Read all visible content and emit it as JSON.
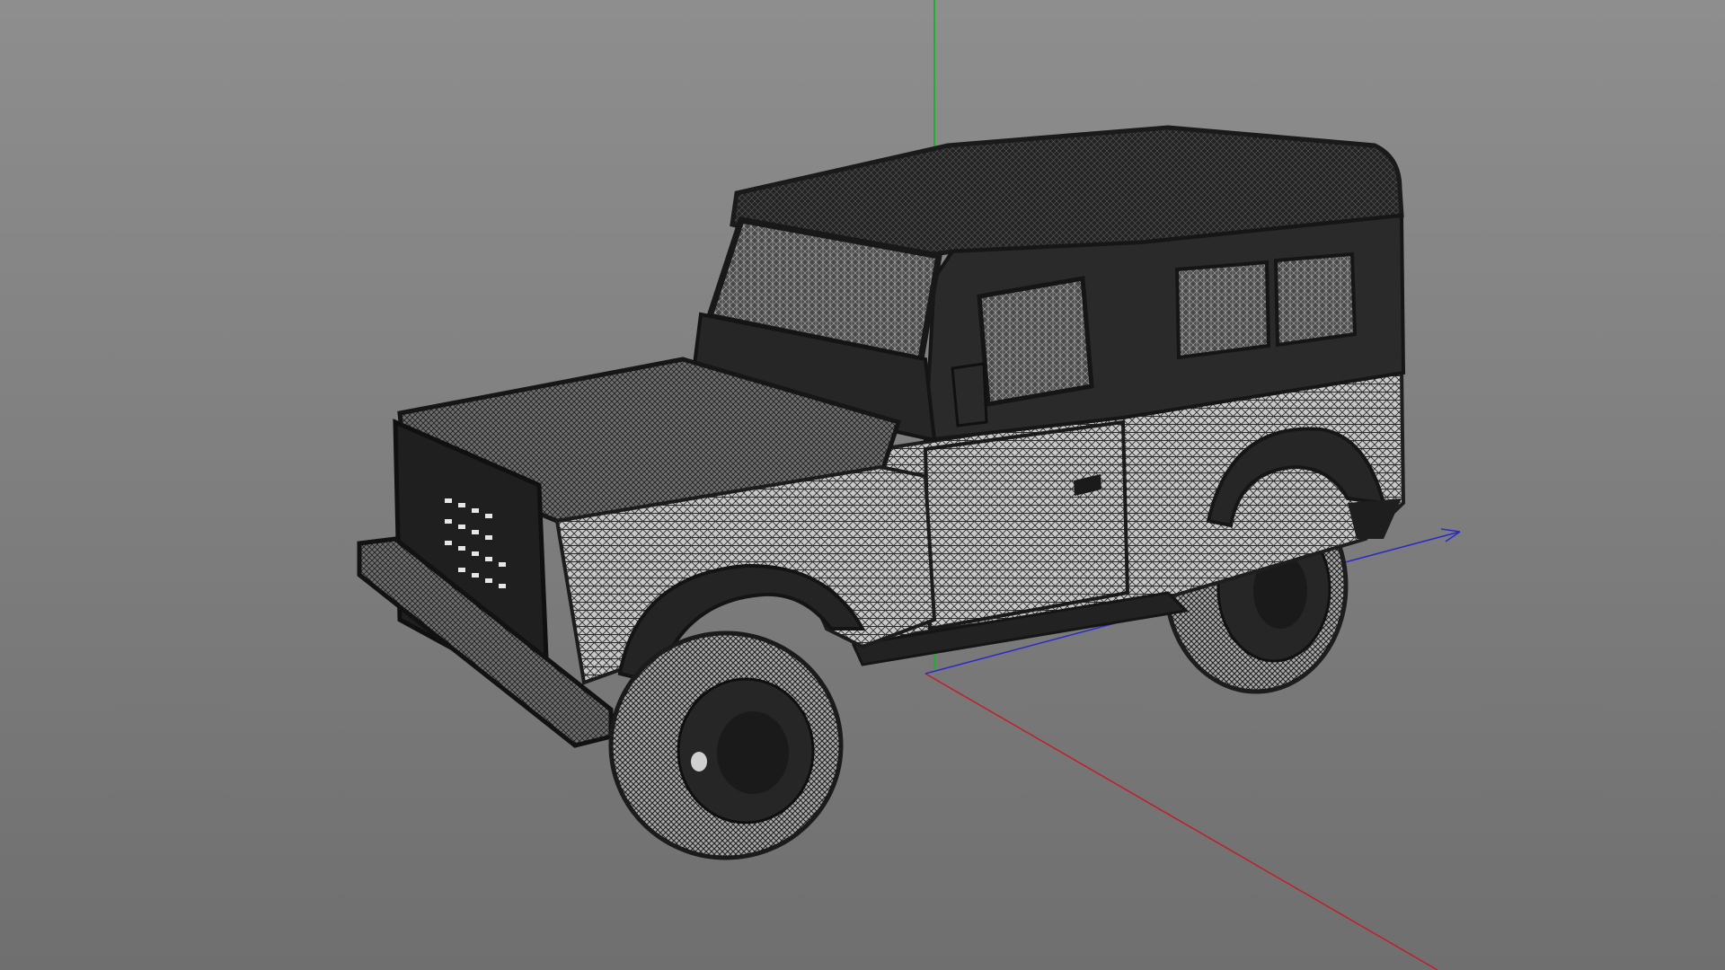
{
  "viewport": {
    "background_top": "#8e8e8e",
    "background_bottom": "#6f6f6f"
  },
  "axes": {
    "x_color": "#c0202a",
    "y_color": "#1fae2f",
    "z_color": "#2a2ac8"
  },
  "model": {
    "name": "off-road-vehicle-wireframe",
    "display_mode": "wireframe",
    "wire_color": "#1e1e1e",
    "highlight_color": "#d8d8d8"
  }
}
